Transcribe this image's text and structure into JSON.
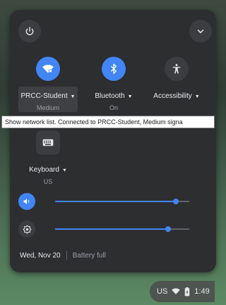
{
  "tray": {
    "power_icon": "power-icon",
    "collapse_icon": "chevron-down-icon"
  },
  "features": {
    "network": {
      "label": "PRCC-Student",
      "sublabel": "Medium",
      "icon": "wifi-locked-icon",
      "active": true
    },
    "bluetooth": {
      "label": "Bluetooth",
      "sublabel": "On",
      "icon": "bluetooth-icon",
      "active": true
    },
    "accessibility": {
      "label": "Accessibility",
      "sublabel": "",
      "icon": "accessibility-icon",
      "active": false
    },
    "keyboard": {
      "label": "Keyboard",
      "sublabel": "US",
      "icon": "keyboard-icon",
      "active": false
    }
  },
  "tooltip": {
    "text": "Show network list. Connected to PRCC-Student, Medium signa"
  },
  "sliders": {
    "volume": {
      "icon": "volume-icon",
      "level": 0.9
    },
    "brightness": {
      "icon": "brightness-icon",
      "level": 0.84
    }
  },
  "footer": {
    "date": "Wed, Nov 20",
    "battery": "Battery full"
  },
  "shelf": {
    "input_method": "US",
    "time": "1:49"
  },
  "colors": {
    "accent": "#4285f4",
    "panel": "#2d2e30"
  }
}
